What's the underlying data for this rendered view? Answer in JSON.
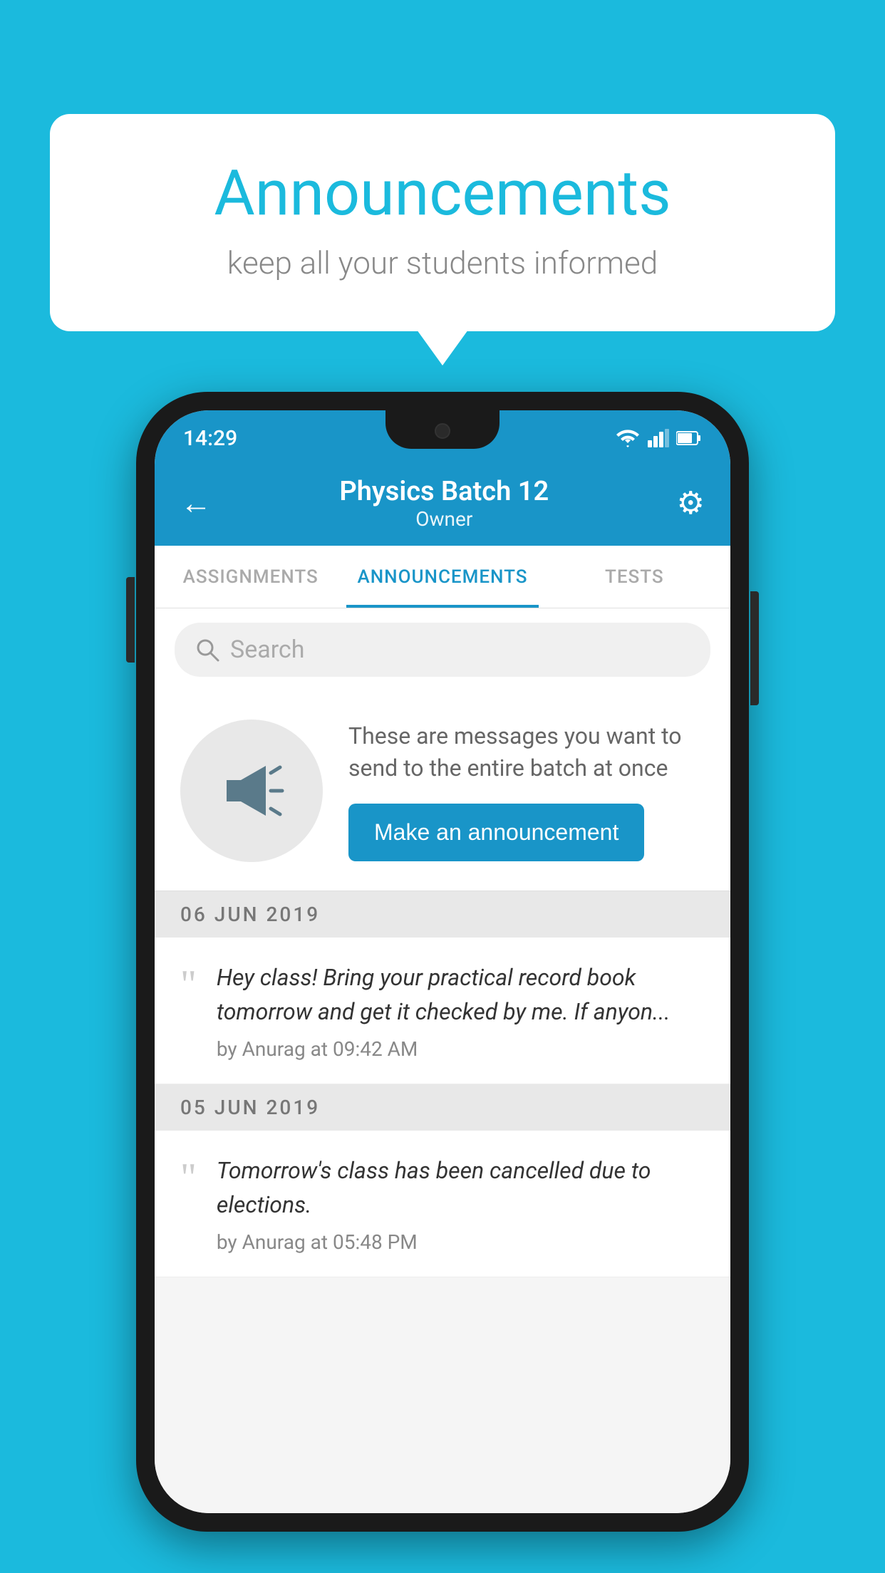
{
  "background_color": "#1BBADD",
  "speech_bubble": {
    "title": "Announcements",
    "subtitle": "keep all your students informed"
  },
  "phone": {
    "status_bar": {
      "time": "14:29",
      "icons": [
        "wifi",
        "signal",
        "battery"
      ]
    },
    "header": {
      "back_label": "←",
      "title": "Physics Batch 12",
      "subtitle": "Owner",
      "settings_label": "⚙"
    },
    "tabs": [
      {
        "label": "ASSIGNMENTS",
        "active": false
      },
      {
        "label": "ANNOUNCEMENTS",
        "active": true
      },
      {
        "label": "TESTS",
        "active": false
      }
    ],
    "search": {
      "placeholder": "Search"
    },
    "announcement_prompt": {
      "description": "These are messages you want to send to the entire batch at once",
      "button_label": "Make an announcement"
    },
    "announcements": [
      {
        "date": "06  JUN  2019",
        "text": "Hey class! Bring your practical record book tomorrow and get it checked by me. If anyon...",
        "meta": "by Anurag at 09:42 AM"
      },
      {
        "date": "05  JUN  2019",
        "text": "Tomorrow's class has been cancelled due to elections.",
        "meta": "by Anurag at 05:48 PM"
      }
    ]
  }
}
